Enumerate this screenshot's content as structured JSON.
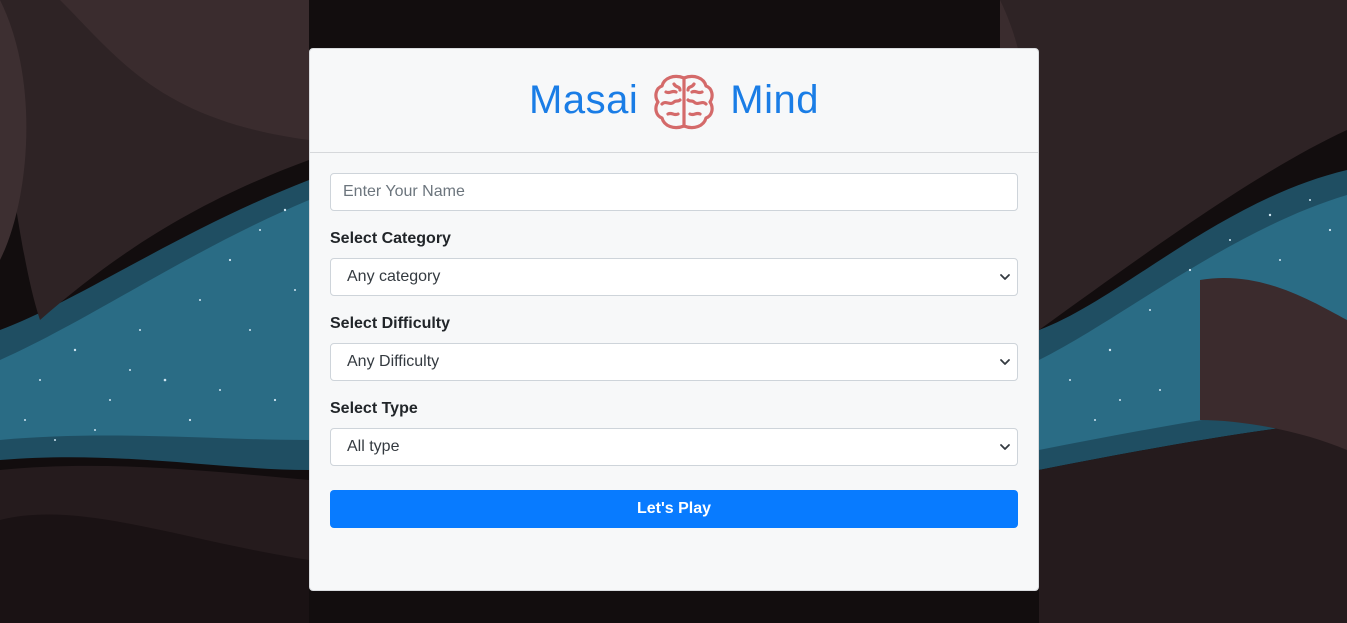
{
  "header": {
    "brand_left": "Masai",
    "brand_right": "Mind",
    "brand_color": "#1a7de6",
    "logo_icon": "brain-icon"
  },
  "form": {
    "name_placeholder": "Enter Your Name",
    "name_value": "",
    "category_label": "Select Category",
    "category_value": "Any category",
    "difficulty_label": "Select Difficulty",
    "difficulty_value": "Any Difficulty",
    "type_label": "Select Type",
    "type_value": "All type",
    "submit_label": "Let's Play",
    "submit_color": "#087bff"
  }
}
